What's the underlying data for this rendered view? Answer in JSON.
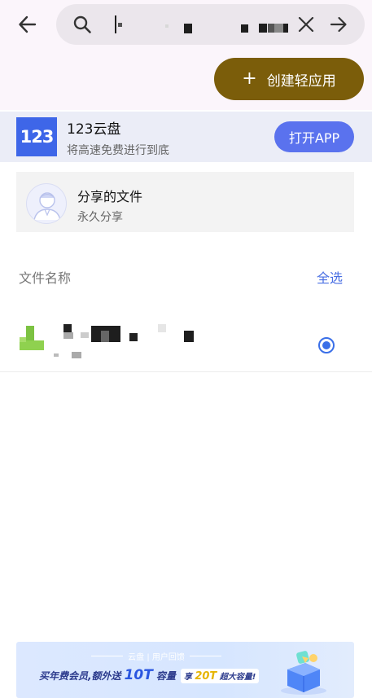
{
  "search": {
    "query_text": "",
    "back_icon": "arrow-left-icon",
    "search_icon": "magnifier-icon",
    "clear_icon": "close-icon",
    "go_icon": "arrow-right-icon"
  },
  "create_button": {
    "plus": "+",
    "label": "创建轻应用",
    "color": "#7b5d0a"
  },
  "app_banner": {
    "logo_text": "123",
    "name": "123云盘",
    "tagline": "将高速免费进行到底",
    "open_button": "打开APP",
    "accent": "#5a72ee"
  },
  "share": {
    "title": "分享的文件",
    "subtitle": "永久分享",
    "avatar_icon": "person-avatar-icon"
  },
  "file_list": {
    "column_header": "文件名称",
    "select_all": "全选",
    "rows": [
      {
        "name": "",
        "selected": true,
        "icon": "file-icon"
      }
    ]
  },
  "promo": {
    "top_text": "云盘 | 用户回馈",
    "main_prefix": "买年费会员,额外送",
    "main_highlight": "10T",
    "main_suffix": "容量",
    "pill_prefix": "享",
    "pill_highlight": "20T",
    "pill_suffix": "超大容量!"
  }
}
